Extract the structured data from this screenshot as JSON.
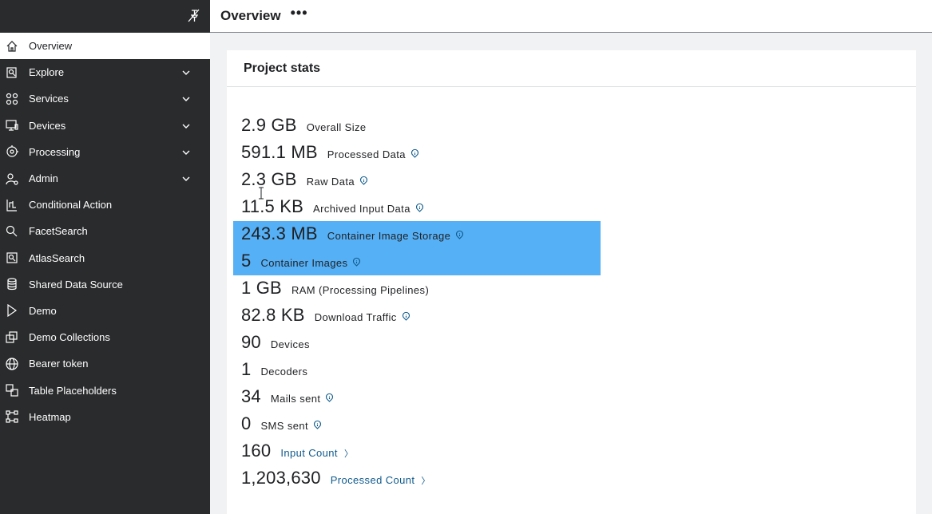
{
  "header": {
    "title": "Overview",
    "more": "•••"
  },
  "sidebar": {
    "items": [
      {
        "label": "Overview",
        "icon": "home-icon",
        "active": true
      },
      {
        "label": "Explore",
        "icon": "explore-icon",
        "expandable": true
      },
      {
        "label": "Services",
        "icon": "services-icon",
        "expandable": true
      },
      {
        "label": "Devices",
        "icon": "devices-icon",
        "expandable": true
      },
      {
        "label": "Processing",
        "icon": "processing-icon",
        "expandable": true
      },
      {
        "label": "Admin",
        "icon": "admin-icon",
        "expandable": true
      },
      {
        "label": "Conditional Action",
        "icon": "conditional-action-icon"
      },
      {
        "label": "FacetSearch",
        "icon": "search-icon"
      },
      {
        "label": "AtlasSearch",
        "icon": "atlas-search-icon"
      },
      {
        "label": "Shared Data Source",
        "icon": "database-icon"
      },
      {
        "label": "Demo",
        "icon": "play-icon"
      },
      {
        "label": "Demo Collections",
        "icon": "collections-icon"
      },
      {
        "label": "Bearer token",
        "icon": "globe-icon"
      },
      {
        "label": "Table Placeholders",
        "icon": "table-placeholder-icon"
      },
      {
        "label": "Heatmap",
        "icon": "heatmap-icon"
      }
    ]
  },
  "card": {
    "title": "Project stats"
  },
  "stats": [
    {
      "value": "2.9 GB",
      "label": "Overall Size",
      "info": false
    },
    {
      "value": "591.1 MB",
      "label": "Processed Data",
      "info": true
    },
    {
      "value": "2.3 GB",
      "label": "Raw Data",
      "info": true
    },
    {
      "value": "11.5 KB",
      "label": "Archived Input Data",
      "info": true
    },
    {
      "value": "243.3 MB",
      "label": "Container Image Storage",
      "info": true,
      "highlight": true
    },
    {
      "value": "5",
      "label": "Container Images",
      "info": true,
      "highlight": true
    },
    {
      "value": "1 GB",
      "label": "RAM (Processing Pipelines)",
      "info": false
    },
    {
      "value": "82.8 KB",
      "label": "Download Traffic",
      "info": true
    },
    {
      "value": "90",
      "label": "Devices",
      "info": false
    },
    {
      "value": "1",
      "label": "Decoders",
      "info": false
    },
    {
      "value": "34",
      "label": "Mails sent",
      "info": true
    },
    {
      "value": "0",
      "label": "SMS sent",
      "info": true
    },
    {
      "value": "160",
      "label": "Input Count",
      "link": true
    },
    {
      "value": "1,203,630",
      "label": "Processed Count",
      "link": true
    }
  ],
  "colors": {
    "sidebar": "#2a2b2d",
    "highlight": "#56b0f5",
    "link": "#0f5a8c"
  }
}
